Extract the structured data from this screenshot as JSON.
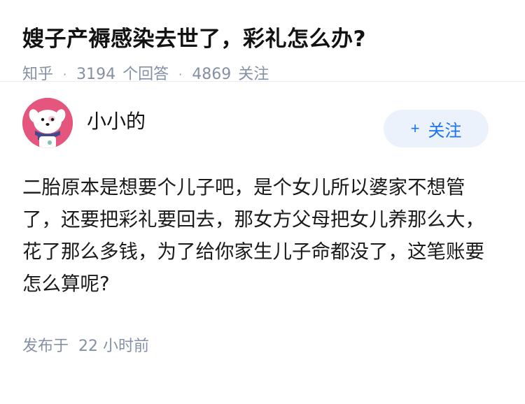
{
  "question": {
    "title": "嫂子产褥感染去世了，彩礼怎么办?",
    "source": "知乎",
    "separator": "·",
    "answer_count": "3194",
    "answer_label": "个回答",
    "follow_count": "4869",
    "follow_label": "关注"
  },
  "answer": {
    "author_name": "小小的",
    "follow_button_label": "关注",
    "follow_button_icon": "+",
    "content": "二胎原本是想要个儿子吧，是个女儿所以婆家不想管了，还要把彩礼要回去，那女方父母把女儿养那么大，花了那么多钱，为了给你家生儿子命都没了，这笔账要怎么算呢?",
    "published_label": "发布于",
    "published_time": "22 小时前"
  },
  "colors": {
    "accent": "#1772f6",
    "follow_bg": "#ebf2fb",
    "meta_gray": "#8590a6",
    "avatar_bg": "#e4567e"
  },
  "icons": {
    "avatar": "cartoon-dog-avatar-icon",
    "follow": "plus-icon"
  }
}
